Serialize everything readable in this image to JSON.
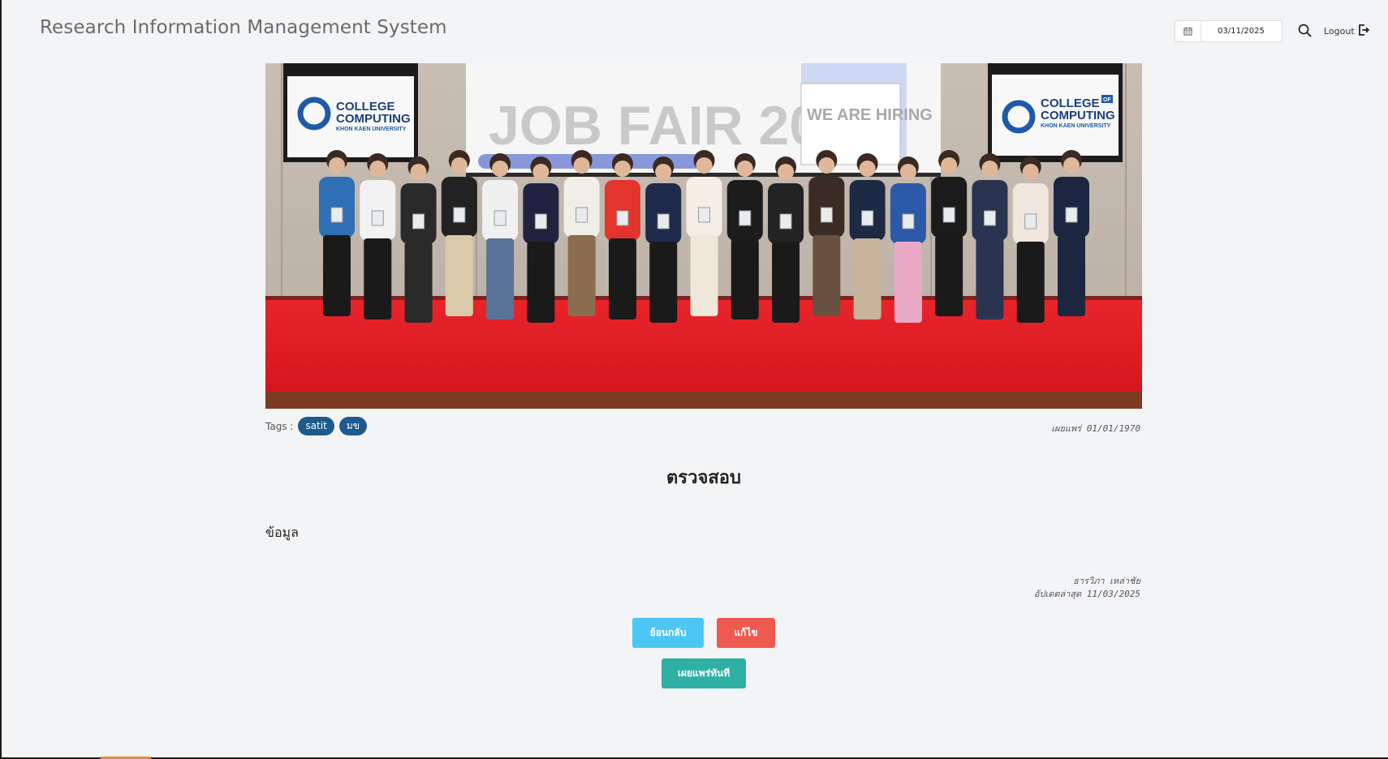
{
  "header": {
    "app_title": "Research Information Management System",
    "date_value": "03/11/2025",
    "logout_label": "Logout"
  },
  "icons": {
    "calendar": "calendar-icon",
    "search": "search-icon",
    "logout": "logout-icon"
  },
  "hero": {
    "banner_text": "JOB FAIR 2025",
    "sign_text": "WE ARE HIRING",
    "logo_left": [
      "COLLEGE",
      "COMPUTING",
      "KHON KAEN UNIVERSITY"
    ],
    "logo_right": [
      "COLLEGE",
      "COMPUTING",
      "KHON KAEN UNIVERSITY"
    ],
    "logo_of": "OF"
  },
  "tags": {
    "label": "Tags :",
    "items": [
      "satit",
      "มข"
    ]
  },
  "article": {
    "published": "เผยแพร่ 01/01/1970",
    "title": "ตรวจสอบ",
    "body": "ข้อมูล",
    "author": "ธารวิภา เหล่าชัย",
    "updated": "อัปเดตล่าสุด 11/03/2025"
  },
  "actions": {
    "back_label": "ย้อนกลับ",
    "edit_label": "แก้ไข",
    "publish_label": "เผยแพร่ทันที"
  },
  "colors": {
    "tag_bg": "#1d5a8d",
    "back_button": "#4cc7f4",
    "edit_button": "#ef5a50",
    "publish_button": "#2fb0a5",
    "page_bg": "#f3f4f6"
  }
}
